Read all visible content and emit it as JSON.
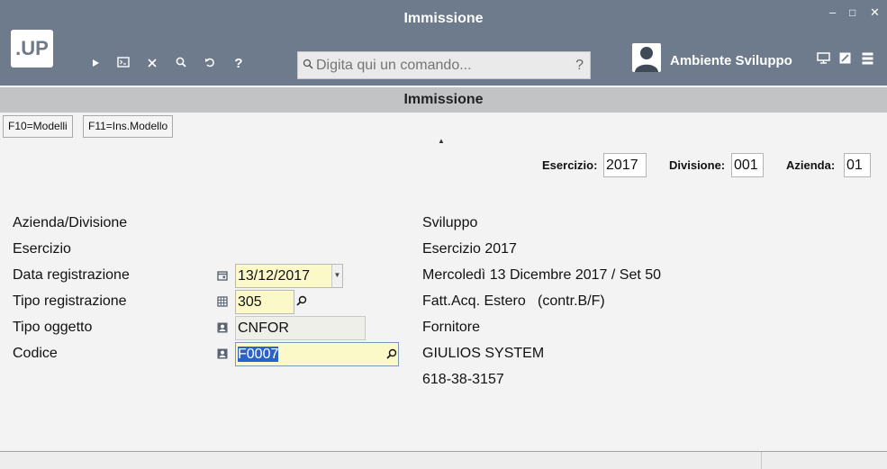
{
  "window": {
    "title": "Immissione",
    "controls": {
      "minimize": "–",
      "maximize": "□",
      "close": "✕"
    }
  },
  "logo": {
    "text": ".UP"
  },
  "toolbar": {
    "icons": [
      "play-icon",
      "terminal-icon",
      "close-icon",
      "search-icon",
      "undo-icon",
      "help-icon"
    ],
    "help_label": "?"
  },
  "command": {
    "placeholder": "Digita qui un comando...",
    "help": "?"
  },
  "user": {
    "name": "Ambiente Sviluppo"
  },
  "header": {
    "title": "Immissione"
  },
  "function_keys": [
    {
      "label": "F10=Modelli"
    },
    {
      "label": "F11=Ins.Modello"
    }
  ],
  "context": {
    "esercizio_label": "Esercizio:",
    "esercizio_value": "2017",
    "divisione_label": "Divisione:",
    "divisione_value": "001",
    "azienda_label": "Azienda:",
    "azienda_value": "01"
  },
  "form": {
    "rows": [
      {
        "label": "Azienda/Divisione",
        "description": "Sviluppo"
      },
      {
        "label": "Esercizio",
        "description": "Esercizio 2017"
      },
      {
        "label": "Data registrazione",
        "value": "13/12/2017",
        "description": "Mercoledì 13 Dicembre 2017 / Set 50"
      },
      {
        "label": "Tipo registrazione",
        "value": "305",
        "description": "Fatt.Acq. Estero   (contr.B/F)"
      },
      {
        "label": "Tipo oggetto",
        "value": "CNFOR",
        "description": "Fornitore"
      },
      {
        "label": "Codice",
        "value": "F0007",
        "description": "GIULIOS SYSTEM"
      }
    ],
    "extra": "618-38-3157"
  },
  "colors": {
    "titlebar": "#6d7b8c",
    "headerbar": "#c1c3c5",
    "field_yellow": "#fcf9c8",
    "selection": "#2a63c8"
  }
}
